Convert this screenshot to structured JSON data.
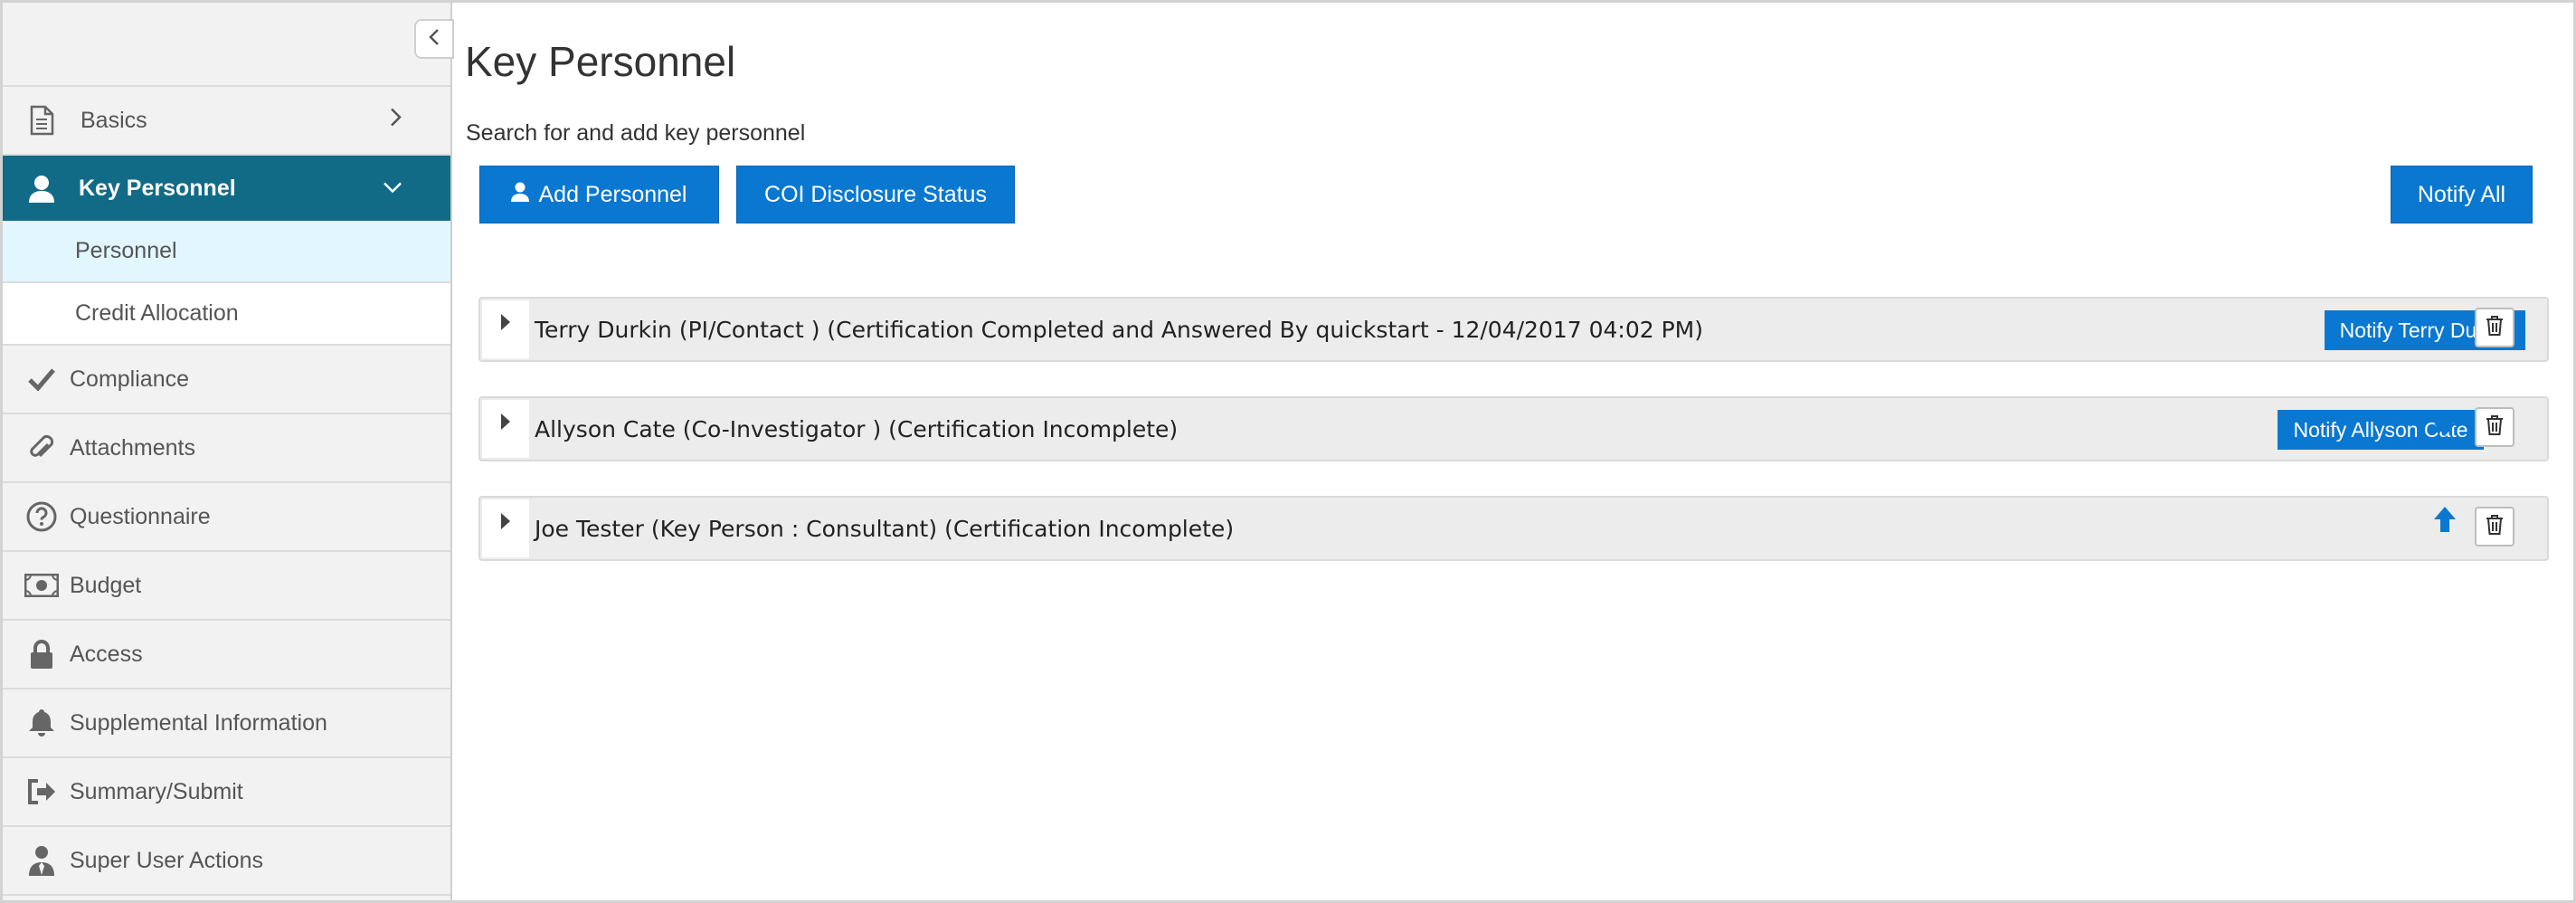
{
  "sidebar": {
    "items": [
      {
        "label": "Basics",
        "icon": "document-icon"
      },
      {
        "label": "Key Personnel",
        "icon": "person-icon",
        "active": true
      },
      {
        "label": "Compliance",
        "icon": "check-icon"
      },
      {
        "label": "Attachments",
        "icon": "paperclip-icon"
      },
      {
        "label": "Questionnaire",
        "icon": "question-circle-icon"
      },
      {
        "label": "Budget",
        "icon": "money-icon"
      },
      {
        "label": "Access",
        "icon": "lock-icon"
      },
      {
        "label": "Supplemental Information",
        "icon": "bell-icon"
      },
      {
        "label": "Summary/Submit",
        "icon": "sign-out-icon"
      },
      {
        "label": "Super User Actions",
        "icon": "user-tie-icon"
      }
    ],
    "subitems": [
      {
        "label": "Personnel",
        "selected": true
      },
      {
        "label": "Credit Allocation"
      }
    ]
  },
  "main": {
    "title": "Key Personnel",
    "subtitle": "Search for and add key personnel",
    "buttons": {
      "add_personnel": "Add Personnel",
      "coi_status": "COI Disclosure Status",
      "notify_all": "Notify All"
    },
    "personnel": [
      {
        "title": "Terry Durkin (PI/Contact ) (Certification Completed and Answered By quickstart - 12/04/2017 04:02 PM)",
        "notify_label": "Notify Terry Durkin"
      },
      {
        "title": "Allyson Cate (Co-Investigator ) (Certification Incomplete)",
        "notify_label": "Notify Allyson Cate"
      },
      {
        "title": "Joe Tester (Key Person : Consultant) (Certification Incomplete)",
        "notify_label": ""
      }
    ]
  },
  "colors": {
    "primary": "#0a78d0",
    "sidebar_active": "#126b86",
    "sidebar_selected": "#e2f6fe"
  }
}
